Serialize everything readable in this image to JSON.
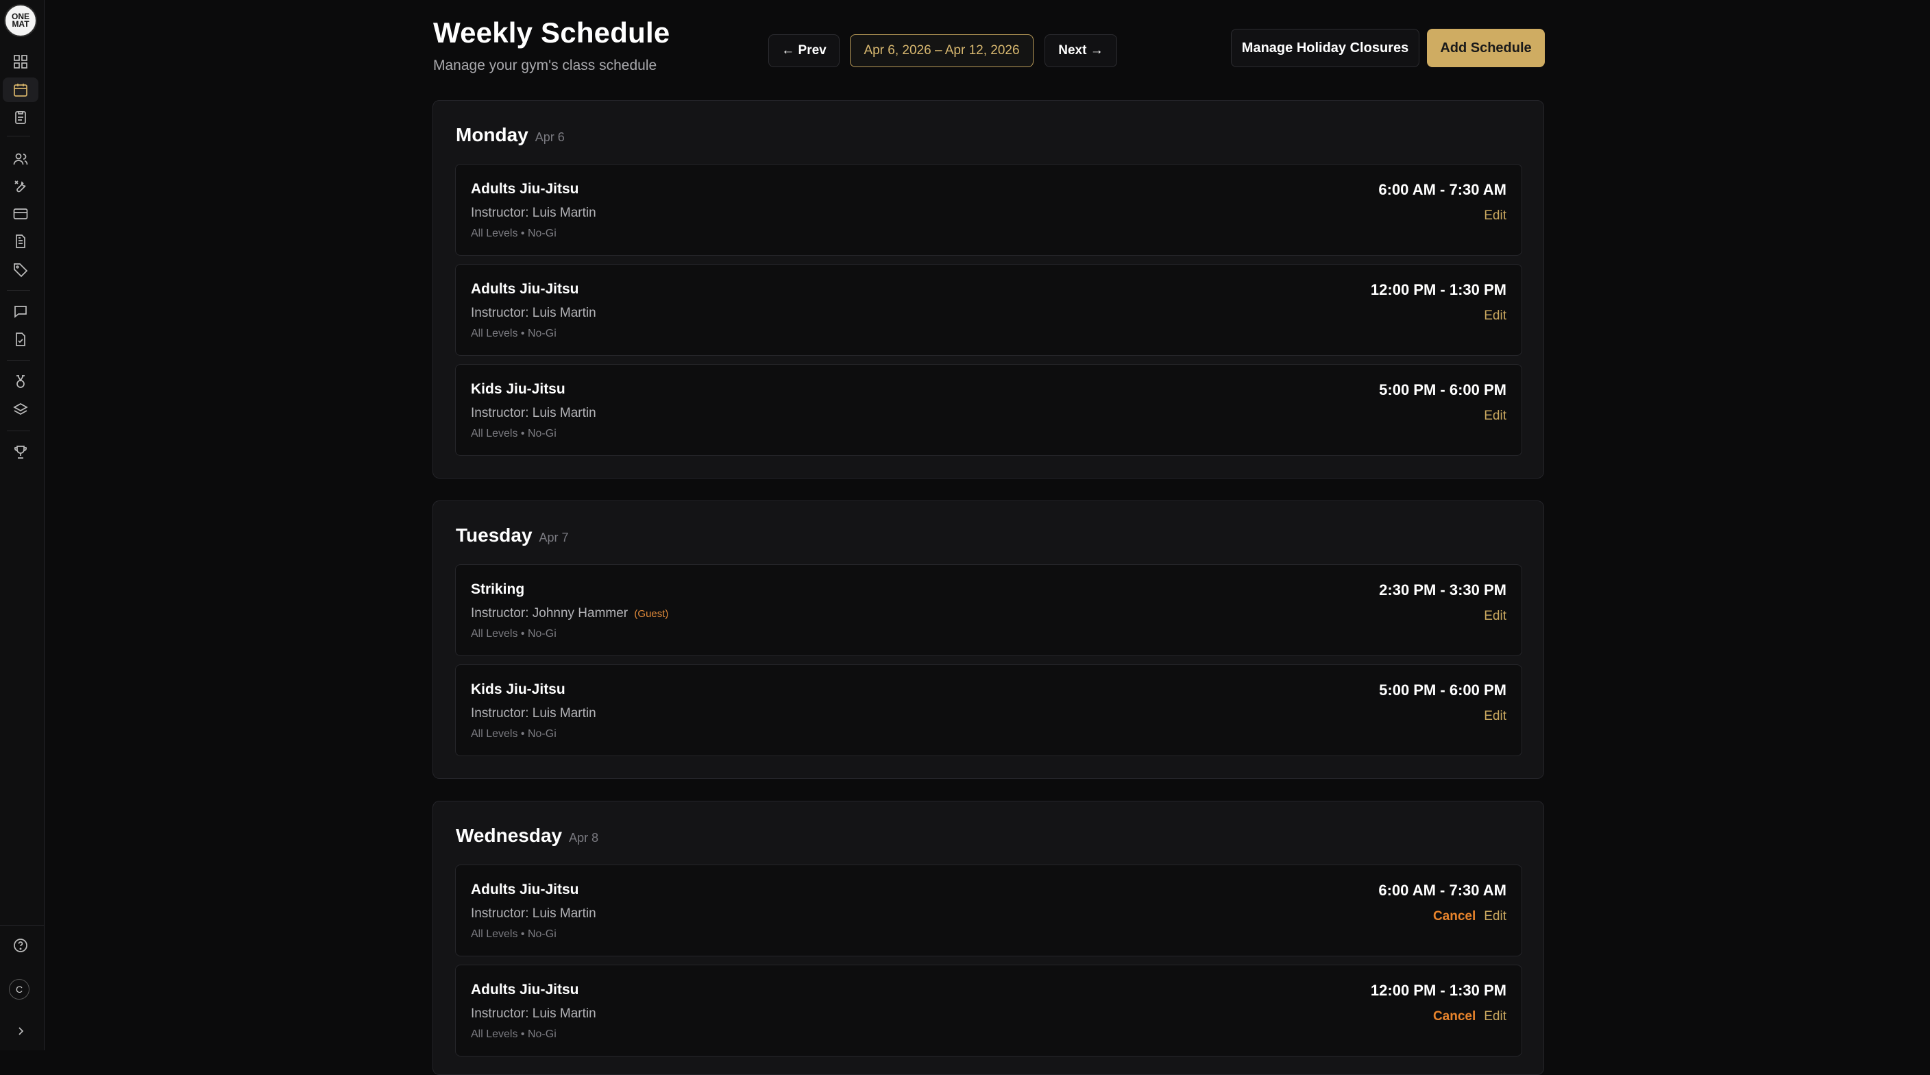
{
  "logo": {
    "line1": "ONE",
    "line2": "MAT"
  },
  "sidebar": {
    "items": [
      {
        "icon": "dashboard-icon"
      },
      {
        "icon": "calendar-icon",
        "active": true
      },
      {
        "icon": "clipboard-icon"
      },
      {
        "icon": "users-icon"
      },
      {
        "icon": "wrench-icon"
      },
      {
        "icon": "credit-card-icon"
      },
      {
        "icon": "document-icon"
      },
      {
        "icon": "tag-icon"
      },
      {
        "icon": "chat-icon"
      },
      {
        "icon": "file-check-icon"
      },
      {
        "icon": "medal-icon"
      },
      {
        "icon": "layers-icon"
      },
      {
        "icon": "trophy-icon"
      }
    ],
    "user_initial": "C"
  },
  "header": {
    "title": "Weekly Schedule",
    "subtitle": "Manage your gym's class schedule",
    "prev_label": "← Prev",
    "range_label": "Apr 6, 2026 – Apr 12, 2026",
    "next_label": "Next →",
    "holiday_label": "Manage Holiday Closures",
    "add_label": "Add Schedule"
  },
  "days": [
    {
      "name": "Monday",
      "date": "Apr 6",
      "classes": [
        {
          "title": "Adults Jiu-Jitsu",
          "instructor": "Instructor: Luis Martin",
          "meta": "All Levels • No-Gi",
          "time": "6:00 AM - 7:30 AM",
          "edit": "Edit"
        },
        {
          "title": "Adults Jiu-Jitsu",
          "instructor": "Instructor: Luis Martin",
          "meta": "All Levels • No-Gi",
          "time": "12:00 PM - 1:30 PM",
          "edit": "Edit"
        },
        {
          "title": "Kids Jiu-Jitsu",
          "instructor": "Instructor: Luis Martin",
          "meta": "All Levels • No-Gi",
          "time": "5:00 PM - 6:00 PM",
          "edit": "Edit"
        }
      ]
    },
    {
      "name": "Tuesday",
      "date": "Apr 7",
      "classes": [
        {
          "title": "Striking",
          "instructor": "Instructor: Johnny Hammer",
          "guest": "(Guest)",
          "meta": "All Levels • No-Gi",
          "time": "2:30 PM - 3:30 PM",
          "edit": "Edit"
        },
        {
          "title": "Kids Jiu-Jitsu",
          "instructor": "Instructor: Luis Martin",
          "meta": "All Levels • No-Gi",
          "time": "5:00 PM - 6:00 PM",
          "edit": "Edit"
        }
      ]
    },
    {
      "name": "Wednesday",
      "date": "Apr 8",
      "classes": [
        {
          "title": "Adults Jiu-Jitsu",
          "instructor": "Instructor: Luis Martin",
          "meta": "All Levels • No-Gi",
          "time": "6:00 AM - 7:30 AM",
          "cancel": "Cancel",
          "edit": "Edit"
        },
        {
          "title": "Adults Jiu-Jitsu",
          "instructor": "Instructor: Luis Martin",
          "meta": "All Levels • No-Gi",
          "time": "12:00 PM - 1:30 PM",
          "cancel": "Cancel",
          "edit": "Edit"
        }
      ]
    }
  ],
  "colors": {
    "accent": "#cfac62",
    "cancel": "#e8842c",
    "background": "#0b0b0c"
  }
}
